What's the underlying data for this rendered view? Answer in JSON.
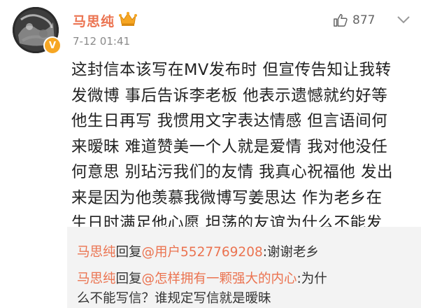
{
  "post": {
    "username": "马思纯",
    "timestamp": "7-12 01:41",
    "like_count": "877",
    "body_lines": [
      "这封信本该写在MV发布时 但宣传告知让我转",
      "发微博 事后告诉李老板 他表示遗憾就约好等",
      "他生日再写 我惯用文字表达情感 但言语间何",
      "来暧昧 难道赞美一个人就是爱情 我对他没任",
      "何意思 别玷污我们的友情 我真心祝福他 发出",
      "来是因为他羡慕我微博写姜思达 作为老乡在",
      "生日时满足他心愿 坦荡的友谊为什么不能发"
    ]
  },
  "replies": [
    {
      "name": "马思纯",
      "verb": "回复",
      "mention": "@用户5527769208",
      "text": ":谢谢老乡"
    },
    {
      "name": "马思纯",
      "verb": "回复",
      "mention": "@怎样拥有一颗强大的内心",
      "text": ":为什",
      "text_cont": "么不能写信？谁规定写信就是暧昧"
    }
  ],
  "colors": {
    "accent": "#eb7350",
    "badge": "#f6a623",
    "reply_bg": "#f3f3f3"
  },
  "icons": {
    "like": "thumbs-up-icon",
    "more": "chevron-down-icon",
    "crown": "crown-icon",
    "verified": "vip-v-icon"
  }
}
